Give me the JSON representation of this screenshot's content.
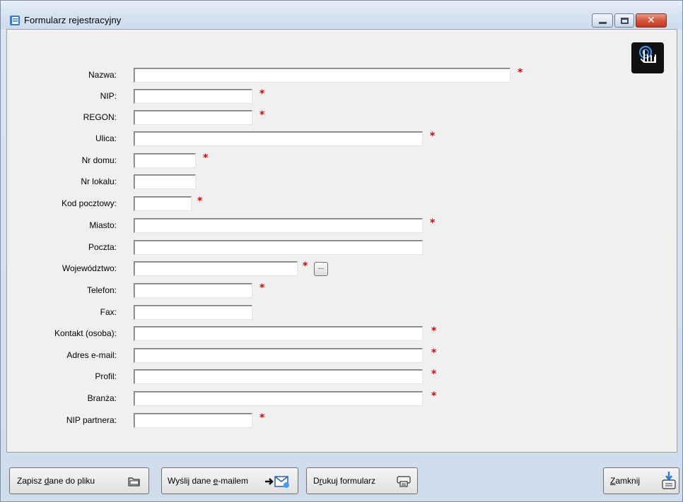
{
  "window": {
    "title": "Formularz rejestracyjny"
  },
  "form": {
    "fields": [
      {
        "label": "Nazwa:",
        "value": "",
        "required": true
      },
      {
        "label": "NIP:",
        "value": "",
        "required": true
      },
      {
        "label": "REGON:",
        "value": "",
        "required": true
      },
      {
        "label": "Ulica:",
        "value": "",
        "required": true
      },
      {
        "label": "Nr domu:",
        "value": "",
        "required": true
      },
      {
        "label": "Nr lokalu:",
        "value": "",
        "required": false
      },
      {
        "label": "Kod pocztowy:",
        "value": "",
        "required": true
      },
      {
        "label": "Miasto:",
        "value": "",
        "required": true
      },
      {
        "label": "Poczta:",
        "value": "",
        "required": false
      },
      {
        "label": "Województwo:",
        "value": "",
        "required": true
      },
      {
        "label": "Telefon:",
        "value": "",
        "required": true
      },
      {
        "label": "Fax:",
        "value": "",
        "required": false
      },
      {
        "label": "Kontakt (osoba):",
        "value": "",
        "required": true
      },
      {
        "label": "Adres e-mail:",
        "value": "",
        "required": true
      },
      {
        "label": "Profil:",
        "value": "",
        "required": true
      },
      {
        "label": "Branża:",
        "value": "",
        "required": true
      },
      {
        "label": "NIP partnera:",
        "value": "",
        "required": true
      }
    ],
    "required_marker": "*",
    "browse_label": "..."
  },
  "buttons": {
    "save_pre": "Zapisz ",
    "save_u": "d",
    "save_post": "ane do pliku",
    "email_pre": "Wyślij dane ",
    "email_u": "e",
    "email_post": "-mailem",
    "print_pre": "D",
    "print_u": "r",
    "print_post": "ukuj formularz",
    "close_u": "Z",
    "close_post": "amknij"
  },
  "colors": {
    "required": "#e00000",
    "client_bg": "#f0f0f0",
    "title_bg": "#d7e3f1"
  },
  "icons": {
    "app": "form-icon",
    "touch": "touch-hand-icon",
    "save": "folder-icon",
    "email": "send-email-icon",
    "print": "printer-icon",
    "close": "exit-icon"
  }
}
